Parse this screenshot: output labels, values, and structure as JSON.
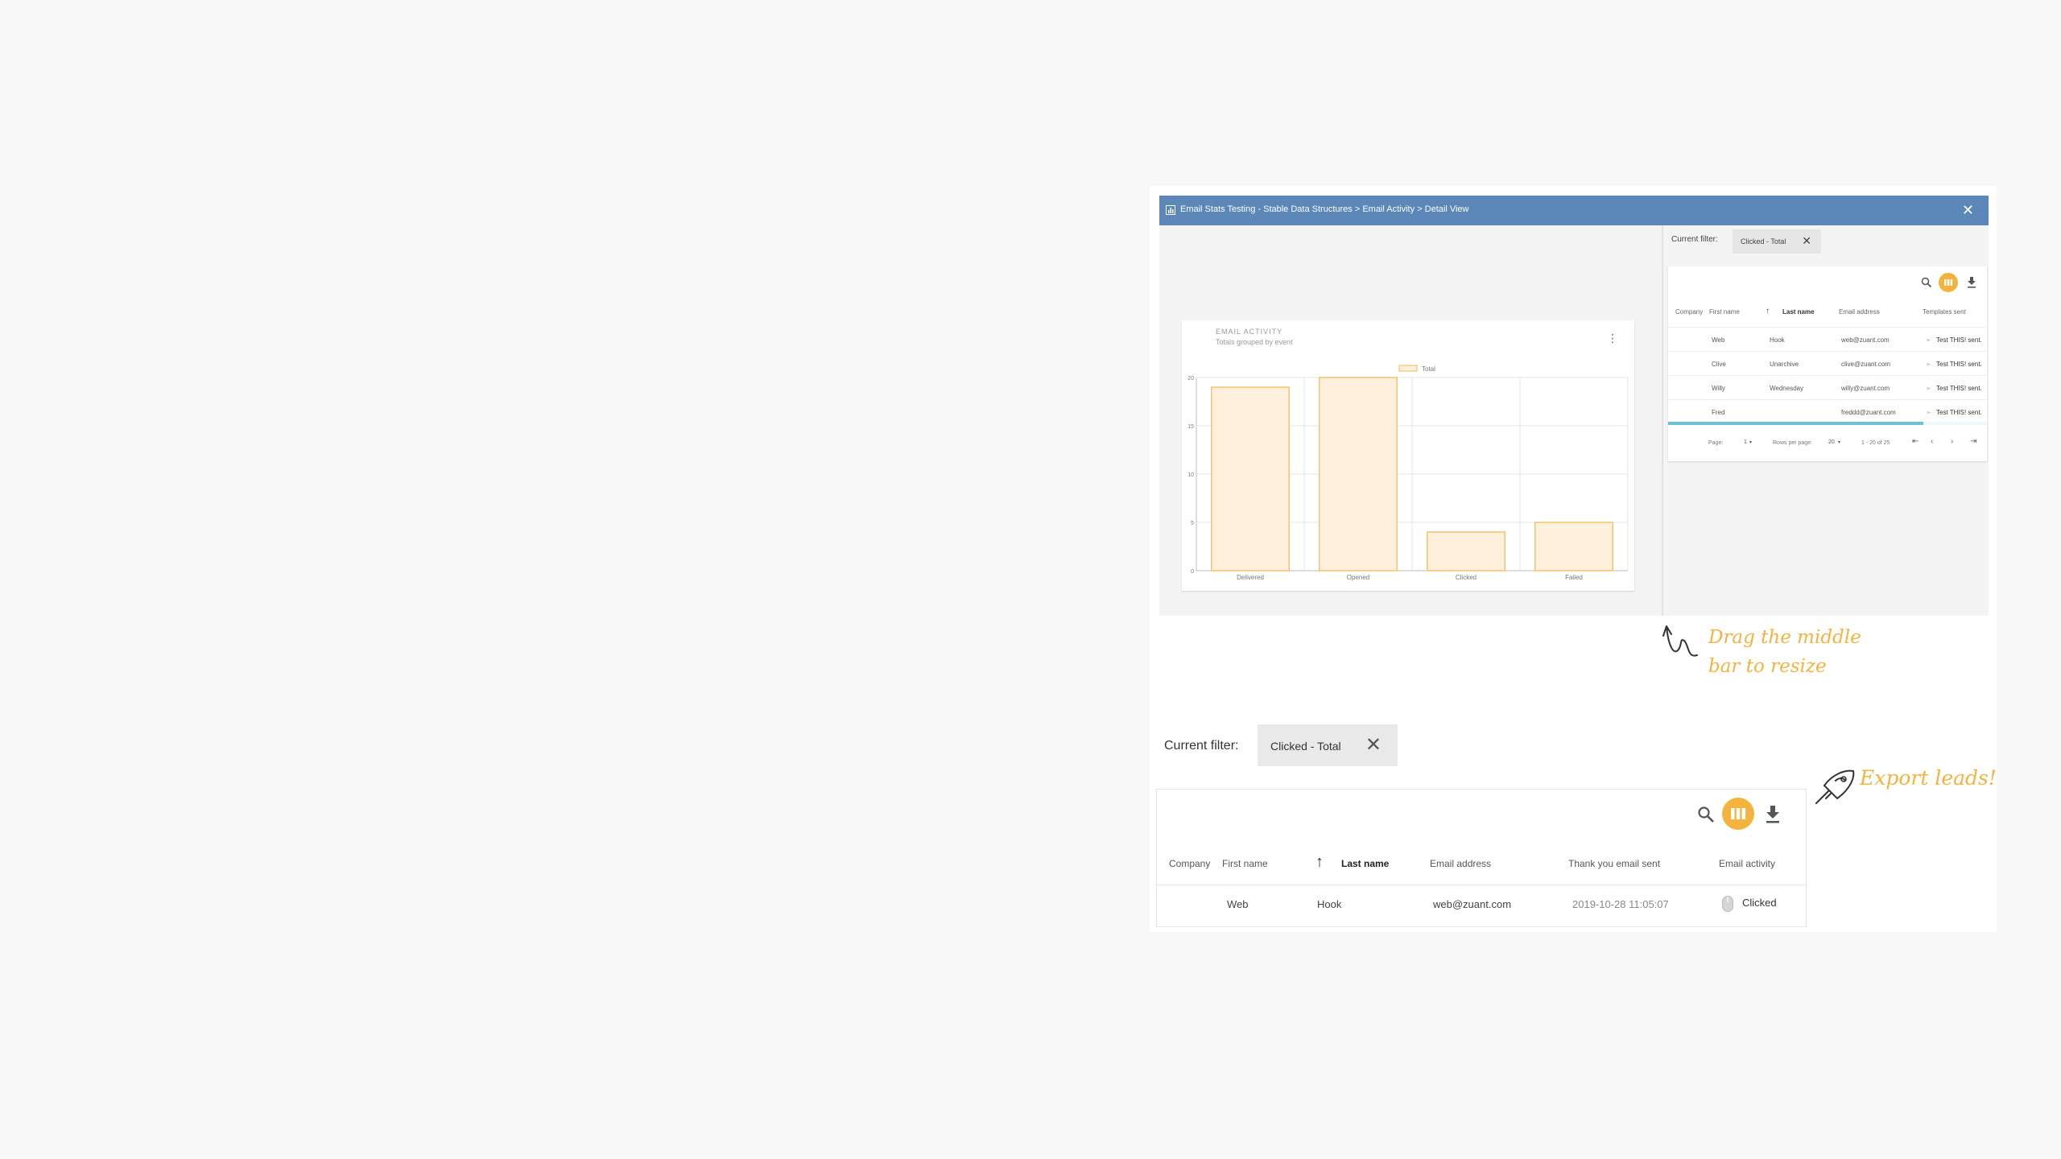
{
  "window": {
    "title": "Email Stats Testing - Stable Data Structures > Email Activity > Detail View",
    "close_icon": "close-icon"
  },
  "chart_panel": {
    "title": "EMAIL ACTIVITY",
    "subtitle": "Totals grouped by event",
    "menu_icon": "more-vert-icon"
  },
  "chart_data": {
    "type": "bar",
    "categories": [
      "Delivered",
      "Opened",
      "Clicked",
      "Failed"
    ],
    "series": [
      {
        "name": "Total",
        "values": [
          19,
          20,
          4,
          5
        ]
      }
    ],
    "yticks": [
      0,
      5,
      10,
      15,
      20
    ],
    "ylim": [
      0,
      20
    ],
    "grid": true,
    "legend": "top-center",
    "colors": {
      "fill": "#fdf1dd",
      "stroke": "#f3c46c"
    }
  },
  "small_filter": {
    "label": "Current filter:",
    "chip": "Clicked - Total"
  },
  "small_table": {
    "columns": [
      "Company",
      "First name",
      "Last name",
      "Email address",
      "Templates sent"
    ],
    "rows": [
      {
        "company": "",
        "first": "Web",
        "last": "Hook",
        "email": "web@zuant.com",
        "template": "Test THIS! sent."
      },
      {
        "company": "",
        "first": "Clive",
        "last": "Unarchive",
        "email": "clive@zuant.com",
        "template": "Test THIS! sent."
      },
      {
        "company": "",
        "first": "Willy",
        "last": "Wednesday",
        "email": "willy@zuant.com",
        "template": "Test THIS! sent."
      },
      {
        "company": "",
        "first": "Fred",
        "last": "",
        "email": "freddd@zuant.com",
        "template": "Test THIS! sent."
      }
    ],
    "footer": {
      "page_label": "Page:",
      "page_value": "1",
      "rows_label": "Rows per page:",
      "rows_value": "20",
      "range": "1 - 20 of 25"
    },
    "progress": 0.8
  },
  "notes": {
    "resize_line1": "Drag the middle",
    "resize_line2": "bar to resize",
    "export": "Export leads!"
  },
  "zoom_filter": {
    "label": "Current filter:",
    "chip": "Clicked - Total"
  },
  "zoom_table": {
    "columns": [
      "Company",
      "First name",
      "Last name",
      "Email address",
      "Thank you email sent",
      "Email activity"
    ],
    "row": {
      "company": "",
      "first": "Web",
      "last": "Hook",
      "email": "web@zuant.com",
      "sent": "2019-10-28 11:05:07",
      "activity": "Clicked"
    }
  },
  "colors": {
    "titlebar": "#5b87b9",
    "accent": "#f3b33d",
    "progress": "#6cc2d0"
  }
}
